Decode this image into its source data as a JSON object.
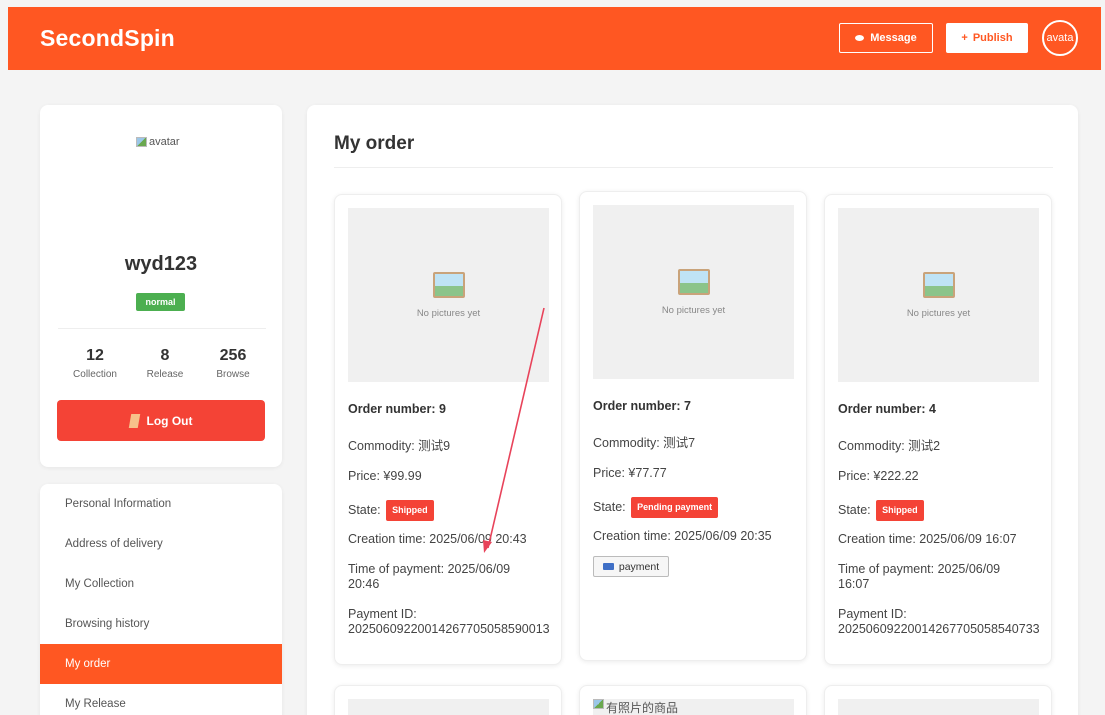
{
  "header": {
    "brand": "SecondSpin",
    "message_label": "Message",
    "publish_label": "Publish",
    "publish_symbol": "+",
    "avatar_alt": "avata"
  },
  "profile": {
    "avatar_alt": "avatar",
    "username": "wyd123",
    "status": "normal",
    "stats": [
      {
        "value": "12",
        "label": "Collection"
      },
      {
        "value": "8",
        "label": "Release"
      },
      {
        "value": "256",
        "label": "Browse"
      }
    ],
    "logout_label": "Log Out"
  },
  "menu": {
    "items": [
      {
        "label": "Personal Information",
        "active": false
      },
      {
        "label": "Address of delivery",
        "active": false
      },
      {
        "label": "My Collection",
        "active": false
      },
      {
        "label": "Browsing history",
        "active": false
      },
      {
        "label": "My order",
        "active": true
      },
      {
        "label": "My Release",
        "active": false
      }
    ]
  },
  "main": {
    "title": "My order",
    "placeholder_text": "No pictures yet",
    "orders": [
      {
        "order_number": "Order number: 9",
        "commodity": "Commodity: 测试9",
        "price": "Price: ¥99.99",
        "state_label": "State:",
        "state": "Shipped",
        "creation": "Creation time: 2025/06/09 20:43",
        "payment_time": "Time of payment: 2025/06/09 20:46",
        "payment_id_label": "Payment ID:",
        "payment_id": "20250609220014267705058590013"
      },
      {
        "order_number": "Order number: 7",
        "commodity": "Commodity: 测试7",
        "price": "Price: ¥77.77",
        "state_label": "State:",
        "state": "Pending payment",
        "creation": "Creation time: 2025/06/09 20:35",
        "pay_button": "payment"
      },
      {
        "order_number": "Order number: 4",
        "commodity": "Commodity: 测试2",
        "price": "Price: ¥222.22",
        "state_label": "State:",
        "state": "Shipped",
        "creation": "Creation time: 2025/06/09 16:07",
        "payment_time": "Time of payment: 2025/06/09 16:07",
        "payment_id_label": "Payment ID:",
        "payment_id": "20250609220014267705058540733"
      }
    ],
    "next_row_image_alt": "有照片的商品"
  },
  "colors": {
    "brand": "#ff5722",
    "danger": "#f44336",
    "success": "#4caf50"
  }
}
